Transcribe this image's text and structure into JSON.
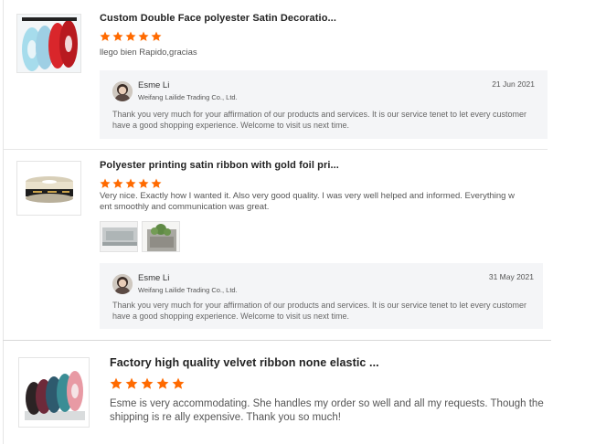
{
  "reviews": [
    {
      "title": "Custom Double Face polyester Satin Decoratio...",
      "rating": 5,
      "comment": "llego bien Rapido,gracias",
      "reply": {
        "name": "Esme Li",
        "company": "Weifang Lailide Trading Co., Ltd.",
        "date": "21 Jun 2021",
        "text": "Thank you very much for your affirmation of our products and services. It is our service tenet to let every customer have a good shopping experience. Welcome to visit us next time."
      }
    },
    {
      "title": "Polyester printing satin ribbon with gold foil pri...",
      "rating": 5,
      "comment": "Very nice. Exactly how I wanted it. Also very good quality. I was very well helped and informed. Everything w ent smoothly and communication was great.",
      "photos": 2,
      "reply": {
        "name": "Esme Li",
        "company": "Weifang Lailide Trading Co., Ltd.",
        "date": "31 May 2021",
        "text": "Thank you very much for your affirmation of our products and services. It is our service tenet to let every customer have a good shopping experience. Welcome to visit us next time."
      }
    },
    {
      "title": "Factory high quality velvet ribbon none elastic ...",
      "rating": 5,
      "comment": "Esme is very accommodating. She handles my order so well and all my requests. Though the shipping is re ally expensive. Thank you so much!"
    }
  ],
  "colors": {
    "star": "#ff6a00",
    "reply_bg": "#f4f5f7"
  }
}
